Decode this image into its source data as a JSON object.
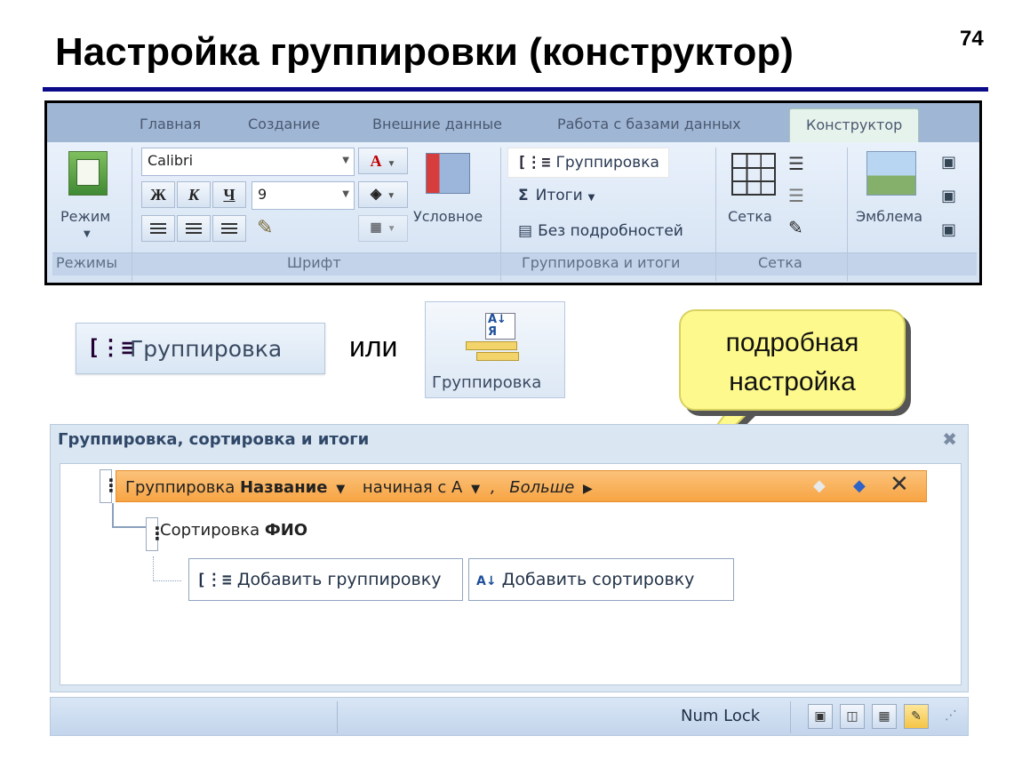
{
  "slide": {
    "title": "Настройка группировки (конструктор)",
    "number": "74"
  },
  "ribbon": {
    "tabs": [
      "Главная",
      "Создание",
      "Внешние данные",
      "Работа с базами данных",
      "Конструктор"
    ],
    "active_tab": "Конструктор",
    "groups": {
      "modes": {
        "label": "Режимы",
        "button": "Режим"
      },
      "font": {
        "label": "Шрифт",
        "font_name": "Calibri",
        "font_size": "9",
        "bold": "Ж",
        "italic": "К",
        "underline": "Ч",
        "conditional": "Условное"
      },
      "grouping": {
        "label": "Группировка и итоги",
        "grouping": "Группировка",
        "totals": "Итоги",
        "no_details": "Без подробностей"
      },
      "grid": {
        "label": "Сетка",
        "button": "Сетка"
      },
      "logo": {
        "button": "Эмблема"
      }
    }
  },
  "middle": {
    "grouping_button": "Группировка",
    "or_text": "или",
    "grouping_button_tall": "Группировка"
  },
  "callout": {
    "line1": "подробная",
    "line2": "настройка"
  },
  "panel": {
    "title": "Группировка, сортировка и итоги",
    "group_row": {
      "prefix": "Группировка",
      "field": "Название",
      "order": "начиная с А",
      "comma": ",",
      "more": "Больше"
    },
    "sort_row": {
      "prefix": "Сортировка",
      "field": "ФИО"
    },
    "add_group": "Добавить группировку",
    "add_sort": "Добавить сортировку"
  },
  "statusbar": {
    "numlock": "Num Lock"
  },
  "colors": {
    "title_rule": "#0b0b8a",
    "group_row": "#f7a443",
    "callout": "#fdf98c",
    "tab_active": "#e6f3ec"
  }
}
